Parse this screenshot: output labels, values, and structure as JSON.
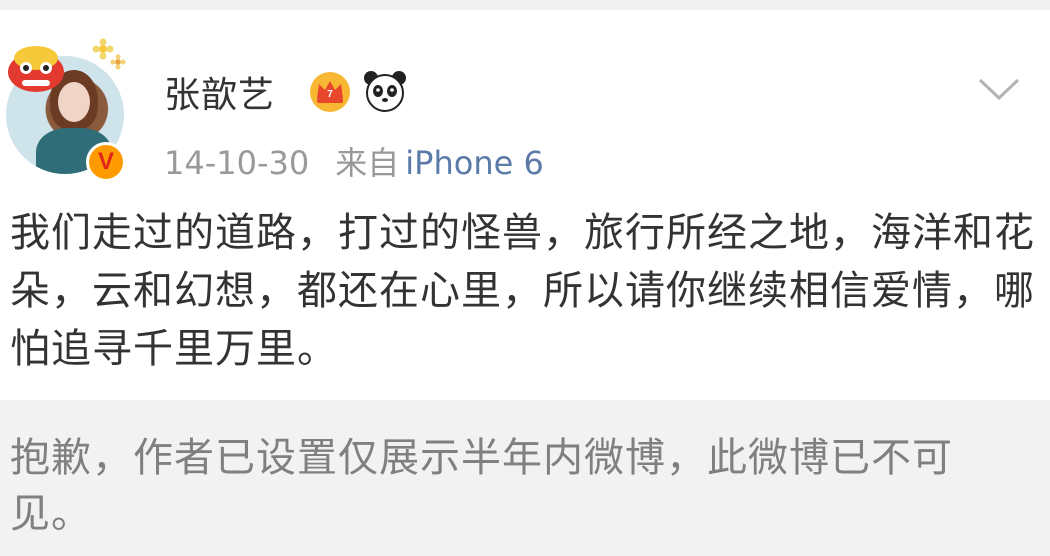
{
  "post": {
    "username": "张歆艺",
    "date": "14-10-30",
    "source_prefix": "来自",
    "device": "iPhone 6",
    "content": "我们走过的道路，打过的怪兽，旅行所经之地，海洋和花朵，云和幻想，都还在心里，所以请你继续相信爱情，哪怕追寻千里万里。",
    "verified_badge": "V"
  },
  "notice": {
    "text": "抱歉，作者已设置仅展示半年内微博，此微博已不可见。"
  },
  "icons": {
    "menu": "chevron-down-icon",
    "crown": "crown-icon",
    "panda": "panda-icon",
    "verified": "verified-badge-icon"
  },
  "colors": {
    "link": "#5b7aa8",
    "meta": "#999999",
    "text": "#333333",
    "notice_bg": "#f2f2f2",
    "verified": "#ff9b00"
  }
}
